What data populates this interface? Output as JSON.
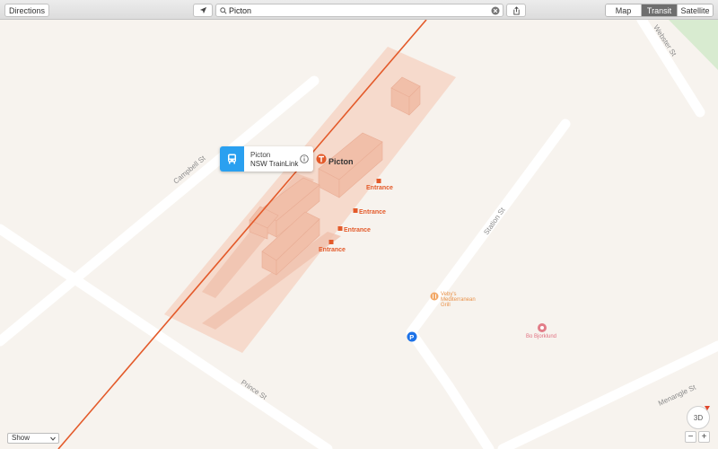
{
  "toolbar": {
    "directions_label": "Directions",
    "location_icon": "location-arrow-icon",
    "search_icon": "magnifier-icon",
    "search_value": "Picton",
    "clear_icon": "clear-x-icon",
    "share_icon": "share-icon",
    "map_types": [
      "Map",
      "Transit",
      "Satellite"
    ],
    "active_map_type": "Transit"
  },
  "map": {
    "streets": [
      "Campbell St",
      "Station St",
      "Prince St",
      "Menangle St",
      "Webster St"
    ],
    "station_name": "Picton",
    "station_icon": "train-T-icon",
    "entrances": [
      "Entrance",
      "Entrance",
      "Entrance",
      "Entrance"
    ],
    "pois": [
      {
        "name": "Veby's Mediterranean Grill",
        "lines": [
          "Veby's",
          "Mediterranean",
          "Grill"
        ],
        "icon": "restaurant-icon"
      },
      {
        "name": "Bo Bjorklund",
        "icon": "poi-pin-icon"
      }
    ],
    "parking_icon": "parking-P-icon",
    "colors": {
      "land": "#f7f3ee",
      "road": "#ffffff",
      "rail": "#e35a2a",
      "station_area": "#f7d6c6",
      "park": "#d8ebd0",
      "transit_blue": "#2aa0f0"
    }
  },
  "callout": {
    "title": "Picton",
    "subtitle": "NSW TrainLink",
    "bus_icon": "bus-icon",
    "info_icon": "info-circle-icon"
  },
  "controls": {
    "show_label": "Show",
    "zoom_out": "−",
    "zoom_in": "+",
    "view_3d": "3D",
    "compass_icon": "compass-icon"
  }
}
